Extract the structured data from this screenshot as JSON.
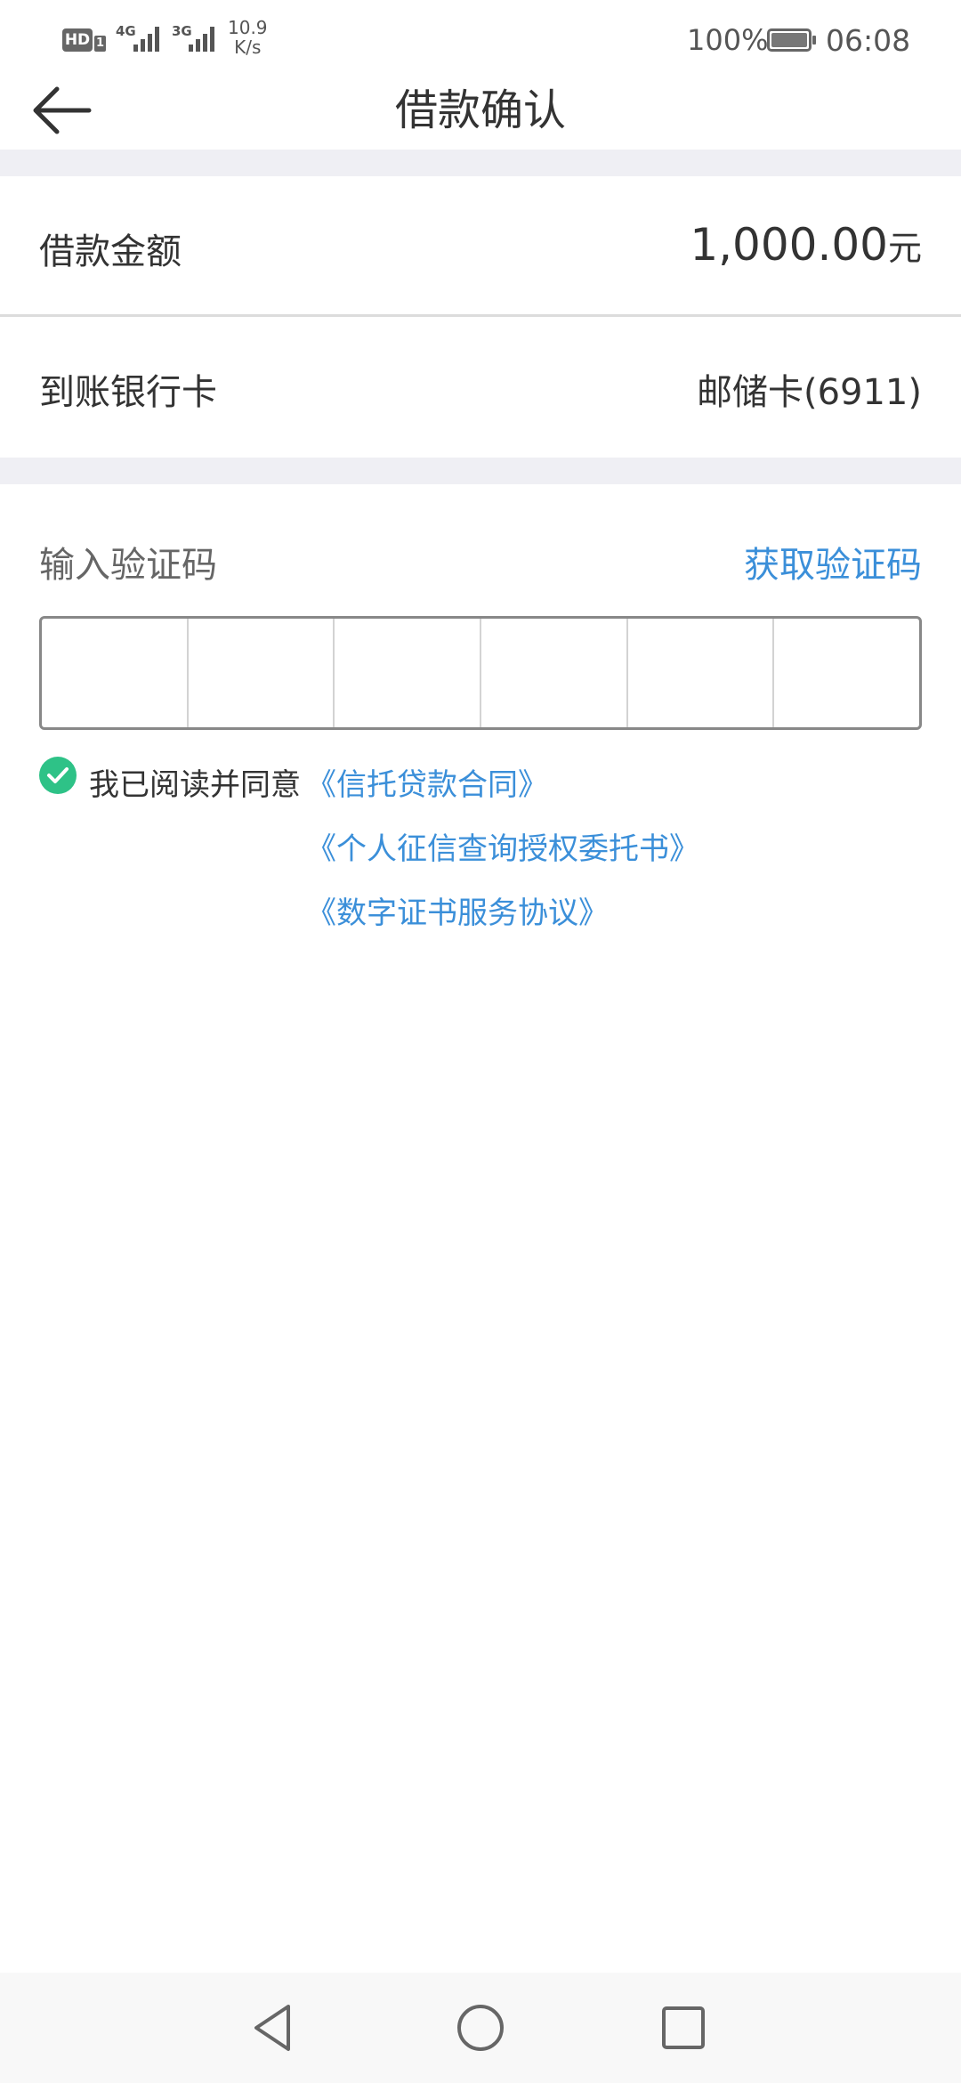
{
  "status_bar": {
    "hd": "HD",
    "sim": "1",
    "net1": "4G",
    "net2": "3G",
    "speed_value": "10.9",
    "speed_unit": "K/s",
    "battery": "100%",
    "time": "06:08"
  },
  "header": {
    "title": "借款确认",
    "back_icon": "arrow-left-icon"
  },
  "loan": {
    "amount_label": "借款金额",
    "amount_value": "1,000.00",
    "amount_unit": "元",
    "bank_label": "到账银行卡",
    "bank_value": "邮储卡(6911)"
  },
  "verification": {
    "label": "输入验证码",
    "get_code": "获取验证码",
    "cells": [
      "",
      "",
      "",
      "",
      "",
      ""
    ]
  },
  "agreement": {
    "checked": true,
    "prefix": "我已阅读并同意",
    "docs": [
      "《信托贷款合同》",
      "《个人征信查询授权委托书》",
      "《数字证书服务协议》"
    ]
  },
  "nav_bar": {
    "back": "triangle-back-icon",
    "home": "circle-home-icon",
    "recent": "square-recent-icon"
  },
  "colors": {
    "accent": "#3b8fd9",
    "check": "#2ec287",
    "section_gap": "#efeff4"
  }
}
